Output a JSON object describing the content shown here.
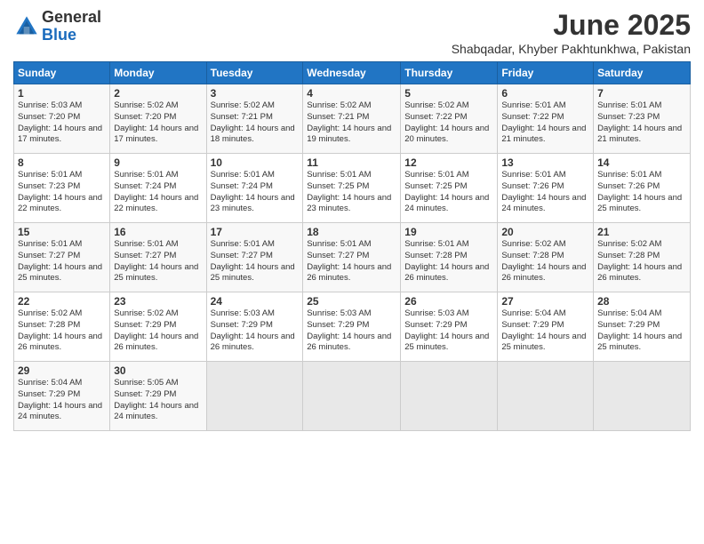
{
  "header": {
    "logo_line1": "General",
    "logo_line2": "Blue",
    "title": "June 2025",
    "subtitle": "Shabqadar, Khyber Pakhtunkhwa, Pakistan"
  },
  "calendar": {
    "days_of_week": [
      "Sunday",
      "Monday",
      "Tuesday",
      "Wednesday",
      "Thursday",
      "Friday",
      "Saturday"
    ],
    "weeks": [
      [
        null,
        {
          "day": "2",
          "sunrise": "Sunrise: 5:02 AM",
          "sunset": "Sunset: 7:20 PM",
          "daylight": "Daylight: 14 hours and 17 minutes."
        },
        {
          "day": "3",
          "sunrise": "Sunrise: 5:02 AM",
          "sunset": "Sunset: 7:21 PM",
          "daylight": "Daylight: 14 hours and 18 minutes."
        },
        {
          "day": "4",
          "sunrise": "Sunrise: 5:02 AM",
          "sunset": "Sunset: 7:21 PM",
          "daylight": "Daylight: 14 hours and 19 minutes."
        },
        {
          "day": "5",
          "sunrise": "Sunrise: 5:02 AM",
          "sunset": "Sunset: 7:22 PM",
          "daylight": "Daylight: 14 hours and 20 minutes."
        },
        {
          "day": "6",
          "sunrise": "Sunrise: 5:01 AM",
          "sunset": "Sunset: 7:22 PM",
          "daylight": "Daylight: 14 hours and 21 minutes."
        },
        {
          "day": "7",
          "sunrise": "Sunrise: 5:01 AM",
          "sunset": "Sunset: 7:23 PM",
          "daylight": "Daylight: 14 hours and 21 minutes."
        }
      ],
      [
        {
          "day": "1",
          "sunrise": "Sunrise: 5:03 AM",
          "sunset": "Sunset: 7:20 PM",
          "daylight": "Daylight: 14 hours and 17 minutes."
        },
        null,
        null,
        null,
        null,
        null,
        null
      ],
      [
        {
          "day": "8",
          "sunrise": "Sunrise: 5:01 AM",
          "sunset": "Sunset: 7:23 PM",
          "daylight": "Daylight: 14 hours and 22 minutes."
        },
        {
          "day": "9",
          "sunrise": "Sunrise: 5:01 AM",
          "sunset": "Sunset: 7:24 PM",
          "daylight": "Daylight: 14 hours and 22 minutes."
        },
        {
          "day": "10",
          "sunrise": "Sunrise: 5:01 AM",
          "sunset": "Sunset: 7:24 PM",
          "daylight": "Daylight: 14 hours and 23 minutes."
        },
        {
          "day": "11",
          "sunrise": "Sunrise: 5:01 AM",
          "sunset": "Sunset: 7:25 PM",
          "daylight": "Daylight: 14 hours and 23 minutes."
        },
        {
          "day": "12",
          "sunrise": "Sunrise: 5:01 AM",
          "sunset": "Sunset: 7:25 PM",
          "daylight": "Daylight: 14 hours and 24 minutes."
        },
        {
          "day": "13",
          "sunrise": "Sunrise: 5:01 AM",
          "sunset": "Sunset: 7:26 PM",
          "daylight": "Daylight: 14 hours and 24 minutes."
        },
        {
          "day": "14",
          "sunrise": "Sunrise: 5:01 AM",
          "sunset": "Sunset: 7:26 PM",
          "daylight": "Daylight: 14 hours and 25 minutes."
        }
      ],
      [
        {
          "day": "15",
          "sunrise": "Sunrise: 5:01 AM",
          "sunset": "Sunset: 7:27 PM",
          "daylight": "Daylight: 14 hours and 25 minutes."
        },
        {
          "day": "16",
          "sunrise": "Sunrise: 5:01 AM",
          "sunset": "Sunset: 7:27 PM",
          "daylight": "Daylight: 14 hours and 25 minutes."
        },
        {
          "day": "17",
          "sunrise": "Sunrise: 5:01 AM",
          "sunset": "Sunset: 7:27 PM",
          "daylight": "Daylight: 14 hours and 25 minutes."
        },
        {
          "day": "18",
          "sunrise": "Sunrise: 5:01 AM",
          "sunset": "Sunset: 7:27 PM",
          "daylight": "Daylight: 14 hours and 26 minutes."
        },
        {
          "day": "19",
          "sunrise": "Sunrise: 5:01 AM",
          "sunset": "Sunset: 7:28 PM",
          "daylight": "Daylight: 14 hours and 26 minutes."
        },
        {
          "day": "20",
          "sunrise": "Sunrise: 5:02 AM",
          "sunset": "Sunset: 7:28 PM",
          "daylight": "Daylight: 14 hours and 26 minutes."
        },
        {
          "day": "21",
          "sunrise": "Sunrise: 5:02 AM",
          "sunset": "Sunset: 7:28 PM",
          "daylight": "Daylight: 14 hours and 26 minutes."
        }
      ],
      [
        {
          "day": "22",
          "sunrise": "Sunrise: 5:02 AM",
          "sunset": "Sunset: 7:28 PM",
          "daylight": "Daylight: 14 hours and 26 minutes."
        },
        {
          "day": "23",
          "sunrise": "Sunrise: 5:02 AM",
          "sunset": "Sunset: 7:29 PM",
          "daylight": "Daylight: 14 hours and 26 minutes."
        },
        {
          "day": "24",
          "sunrise": "Sunrise: 5:03 AM",
          "sunset": "Sunset: 7:29 PM",
          "daylight": "Daylight: 14 hours and 26 minutes."
        },
        {
          "day": "25",
          "sunrise": "Sunrise: 5:03 AM",
          "sunset": "Sunset: 7:29 PM",
          "daylight": "Daylight: 14 hours and 26 minutes."
        },
        {
          "day": "26",
          "sunrise": "Sunrise: 5:03 AM",
          "sunset": "Sunset: 7:29 PM",
          "daylight": "Daylight: 14 hours and 25 minutes."
        },
        {
          "day": "27",
          "sunrise": "Sunrise: 5:04 AM",
          "sunset": "Sunset: 7:29 PM",
          "daylight": "Daylight: 14 hours and 25 minutes."
        },
        {
          "day": "28",
          "sunrise": "Sunrise: 5:04 AM",
          "sunset": "Sunset: 7:29 PM",
          "daylight": "Daylight: 14 hours and 25 minutes."
        }
      ],
      [
        {
          "day": "29",
          "sunrise": "Sunrise: 5:04 AM",
          "sunset": "Sunset: 7:29 PM",
          "daylight": "Daylight: 14 hours and 24 minutes."
        },
        {
          "day": "30",
          "sunrise": "Sunrise: 5:05 AM",
          "sunset": "Sunset: 7:29 PM",
          "daylight": "Daylight: 14 hours and 24 minutes."
        },
        null,
        null,
        null,
        null,
        null
      ]
    ]
  }
}
